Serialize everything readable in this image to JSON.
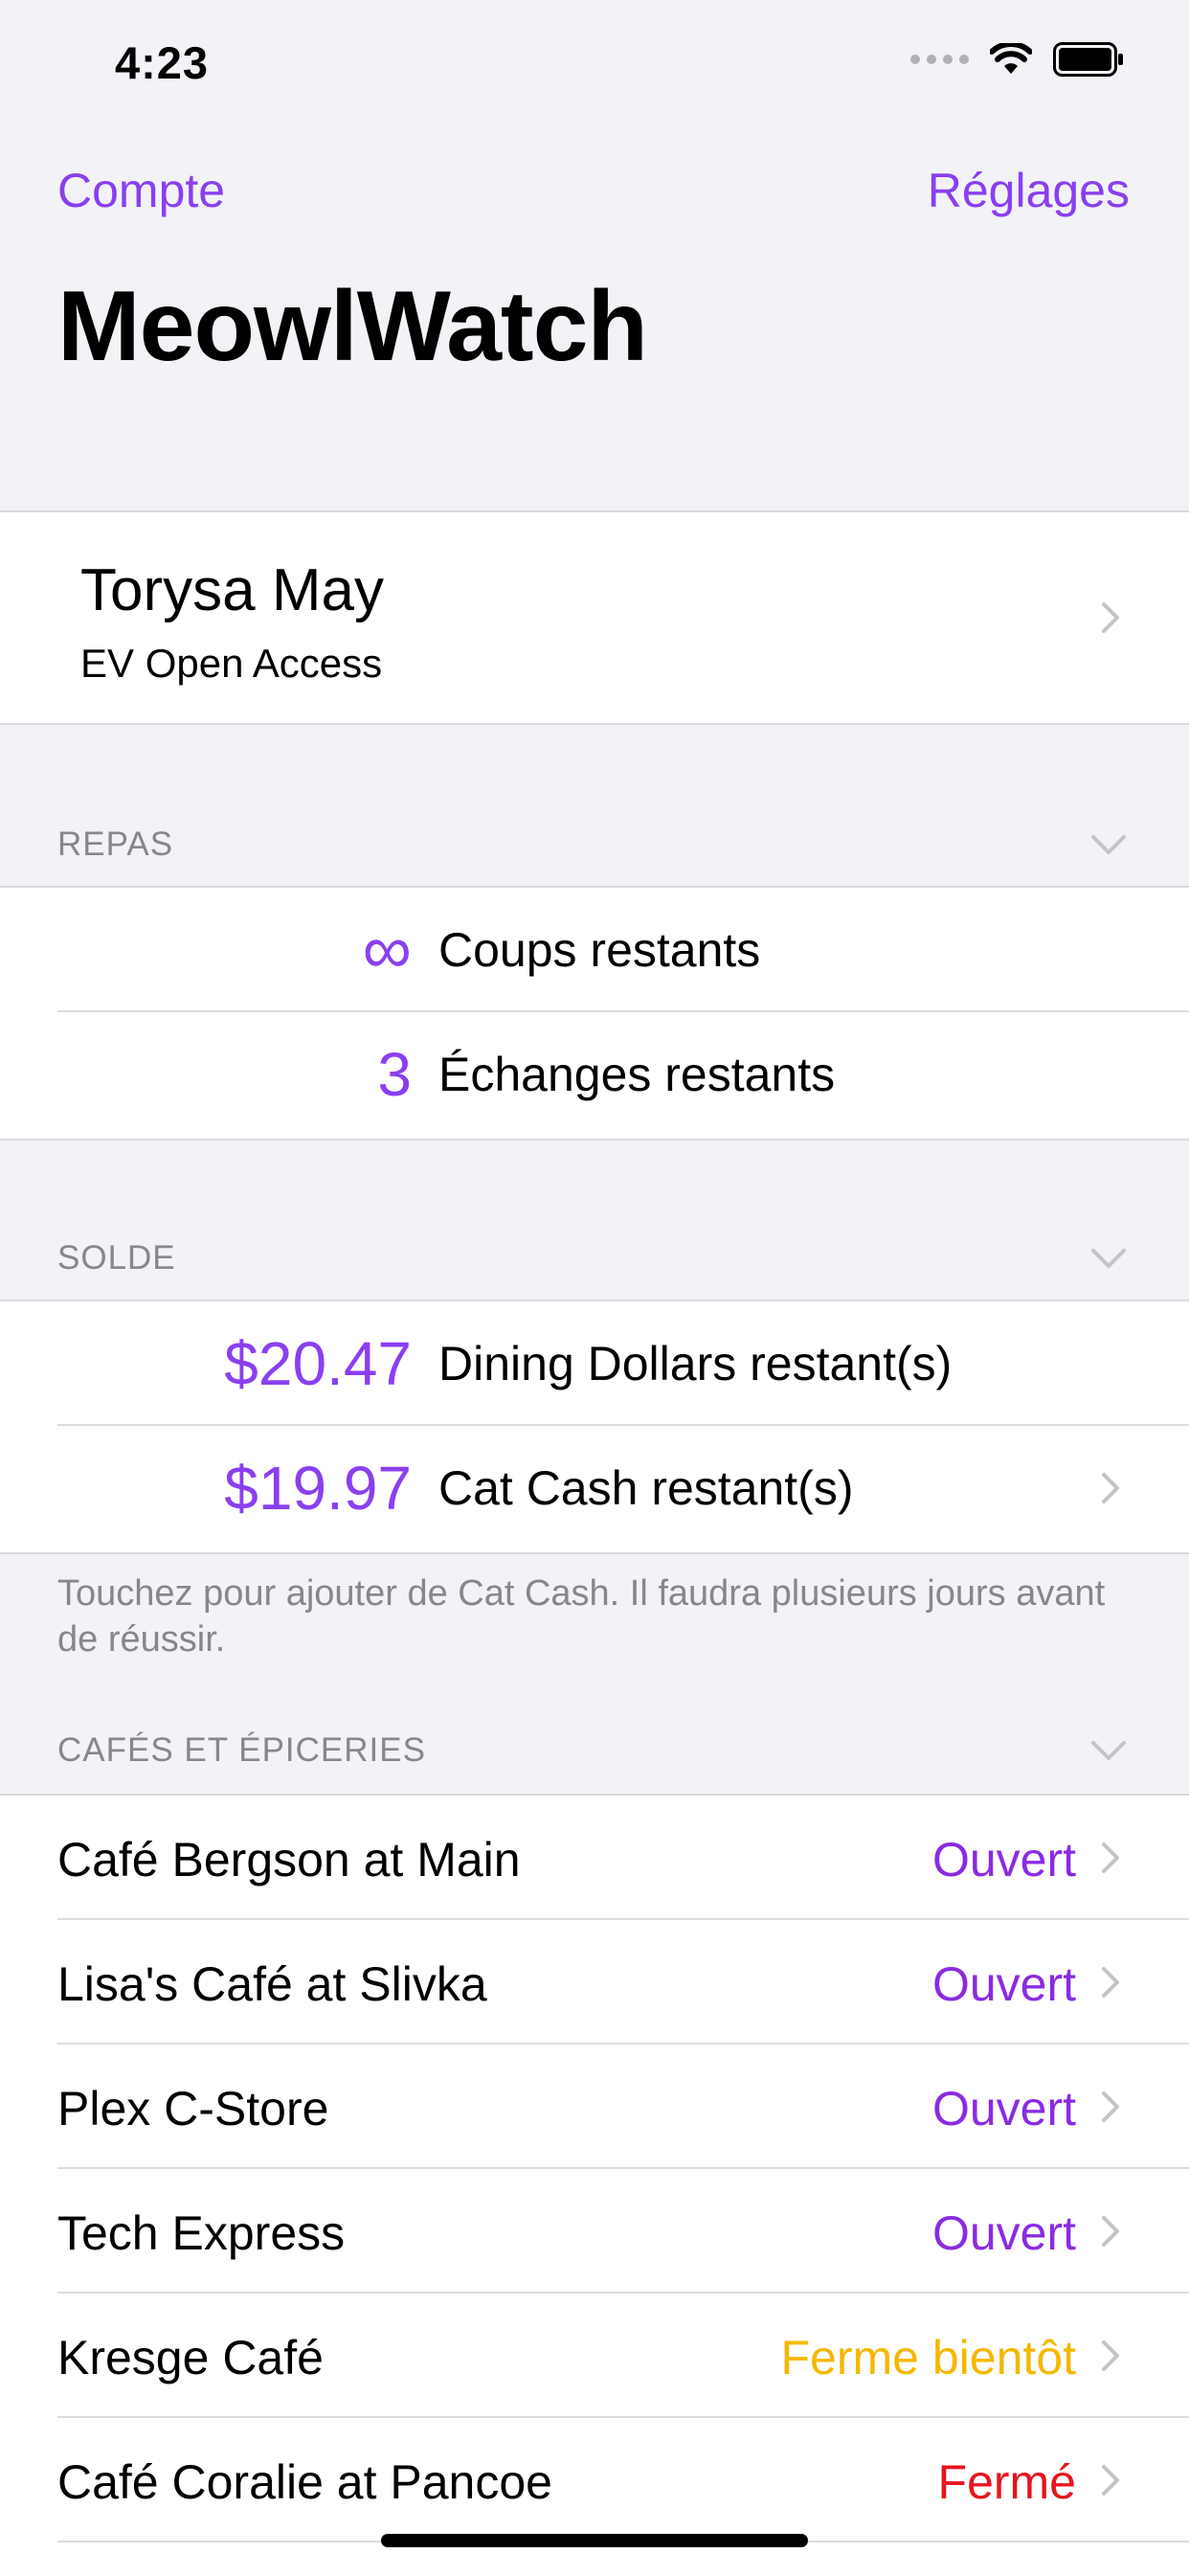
{
  "status_bar": {
    "time": "4:23"
  },
  "nav": {
    "left_label": "Compte",
    "right_label": "Réglages",
    "title": "MeowlWatch"
  },
  "account": {
    "name": "Torysa May",
    "plan": "EV Open Access"
  },
  "meals": {
    "header": "REPAS",
    "rows": [
      {
        "value": "∞",
        "label": "Coups restants"
      },
      {
        "value": "3",
        "label": "Échanges restants"
      }
    ]
  },
  "balance": {
    "header": "SOLDE",
    "rows": [
      {
        "value": "$20.47",
        "label": "Dining Dollars restant(s)"
      },
      {
        "value": "$19.97",
        "label": "Cat Cash restant(s)"
      }
    ],
    "footnote": "Touchez pour ajouter de Cat Cash. Il faudra plusieurs jours avant de réussir."
  },
  "cafes": {
    "header": "CAFÉS ET ÉPICERIES",
    "items": [
      {
        "name": "Café Bergson at Main",
        "status": "Ouvert",
        "status_color": "#8a2be2"
      },
      {
        "name": "Lisa's Café at Slivka",
        "status": "Ouvert",
        "status_color": "#8a2be2"
      },
      {
        "name": "Plex C-Store",
        "status": "Ouvert",
        "status_color": "#8a2be2"
      },
      {
        "name": "Tech Express",
        "status": "Ouvert",
        "status_color": "#8a2be2"
      },
      {
        "name": "Kresge Café",
        "status": "Ferme bientôt",
        "status_color": "#f5b800"
      },
      {
        "name": "Café Coralie at Pancoe",
        "status": "Fermé",
        "status_color": "#e8141e"
      }
    ]
  },
  "colors": {
    "accent": "#8a3ff0",
    "background": "#f2f2f7"
  }
}
